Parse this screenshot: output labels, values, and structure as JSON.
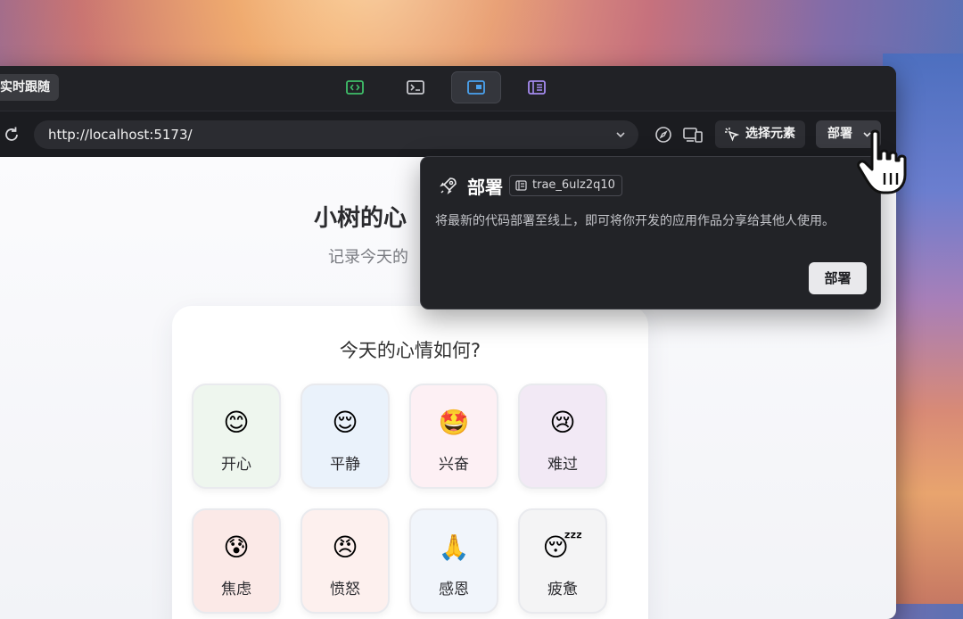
{
  "toolbar": {
    "follow_label": "实时跟随",
    "view_icons": [
      "code-view-icon",
      "terminal-view-icon",
      "browser-view-icon",
      "docs-view-icon"
    ]
  },
  "address_bar": {
    "url": "http://localhost:5173/",
    "select_element_label": "选择元素",
    "deploy_label": "部署"
  },
  "page": {
    "title": "小树的心",
    "subtitle": "记录今天的",
    "card_title": "今天的心情如何?",
    "moods": [
      {
        "emoji": "😊",
        "label": "开心",
        "bg": "#eef6ee"
      },
      {
        "emoji": "😌",
        "label": "平静",
        "bg": "#eaf2fb"
      },
      {
        "emoji": "🤩",
        "label": "兴奋",
        "bg": "#fdf0f4"
      },
      {
        "emoji": "😢",
        "label": "难过",
        "bg": "#f2e9f5"
      },
      {
        "emoji": "😰",
        "label": "焦虑",
        "bg": "#fbe9e7"
      },
      {
        "emoji": "😠",
        "label": "愤怒",
        "bg": "#fdf0ee"
      },
      {
        "emoji": "🙏",
        "label": "感恩",
        "bg": "#f1f5fb"
      },
      {
        "emoji": "😴",
        "label": "疲惫",
        "bg": "#f4f4f5"
      }
    ]
  },
  "popover": {
    "title": "部署",
    "project_tag": "trae_6ulz2q10",
    "description": "将最新的代码部署至线上，即可将你开发的应用作品分享给其他人使用。",
    "confirm_label": "部署"
  },
  "colors": {
    "code_icon": "#3fbf6a",
    "browser_icon": "#4aa3f0",
    "docs_icon": "#a58bf0"
  }
}
